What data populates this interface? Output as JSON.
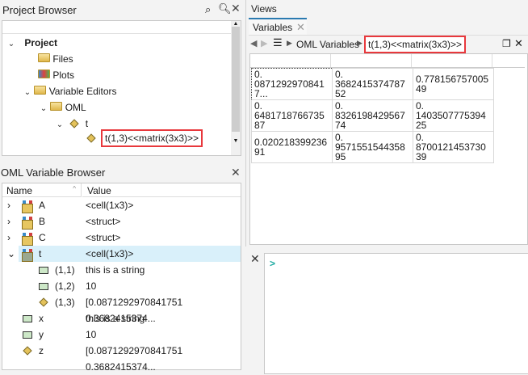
{
  "project_browser": {
    "title": "Project Browser",
    "tree": [
      {
        "label": "Project",
        "icon": "project"
      },
      {
        "label": "Files",
        "icon": "folder-icon"
      },
      {
        "label": "Plots",
        "icon": "plots-icon"
      },
      {
        "label": "Variable Editors",
        "icon": "folder-icon"
      },
      {
        "label": "OML",
        "icon": "folder-icon"
      },
      {
        "label": "t",
        "icon": "matrix-icon"
      },
      {
        "label": "t(1,3)<<matrix(3x3)>>",
        "icon": "matrix-icon"
      }
    ]
  },
  "variable_browser": {
    "title": "OML Variable Browser",
    "col_name": "Name",
    "col_value": "Value",
    "rows": [
      {
        "name": "A",
        "value": "<cell(1x3)>"
      },
      {
        "name": "B",
        "value": "<struct>"
      },
      {
        "name": "C",
        "value": "<struct>"
      },
      {
        "name": "t",
        "value": "<cell(1x3)>"
      },
      {
        "name": "(1,1)",
        "value": "this is a string"
      },
      {
        "name": "(1,2)",
        "value": "10"
      },
      {
        "name": "(1,3)",
        "value": "[0.0871292970841751 0.3682415374..."
      },
      {
        "name": "x",
        "value": "this is a string"
      },
      {
        "name": "y",
        "value": "10"
      },
      {
        "name": "z",
        "value": "[0.0871292970841751 0.3682415374..."
      }
    ]
  },
  "views": {
    "title": "Views",
    "tab": "Variables",
    "breadcrumb": [
      "OML Variables",
      "t(1,3)<<matrix(3x3)>>"
    ],
    "grid": [
      [
        "0.\n08712929708417...",
        "0.\n368241537478752",
        "0.77815675700549"
      ],
      [
        "0.\n648171876673587",
        "0.\n832619842956774",
        "0.\n140350777539425"
      ],
      [
        "0.02021839923691",
        "0.\n957155154435895",
        "0.\n870012145373039"
      ]
    ]
  },
  "console": {
    "prompt": ">"
  }
}
